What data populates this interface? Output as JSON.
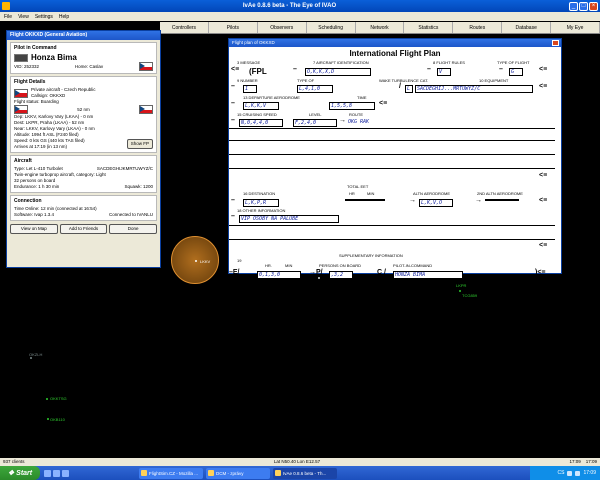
{
  "window": {
    "title": "IvAe 0.8.6 beta - The Eye of IVAO"
  },
  "menu": [
    "File",
    "View",
    "Settings",
    "Help"
  ],
  "toolbar": [
    "Controllers",
    "Pilots",
    "Observers",
    "Scheduling",
    "Network",
    "Statistics",
    "Routes",
    "Database",
    "My Eye"
  ],
  "pilot_panel": {
    "title": "Flight OKKXD (General Aviation)",
    "sec_pilot": "Pilot in Command",
    "pilot_name": "Honza Bima",
    "vid": "VID: 252332",
    "home": "Home: Caslav",
    "sec_details": "Flight Details",
    "aircraft_info": "Private aircraft - Czech Republic",
    "callsign": "Callsign: OKKXD",
    "status": "Flight status: Boarding",
    "distance": "52 nm",
    "dep": "Dep: LKKV, Karlovy Vary (LKAA) - 0 nm",
    "dest": "Dest: LKPR, Praha (LKAA) - 52 nm",
    "near": "Near: LKKV, Karlovy Vary (LKAA) - 0 nm",
    "altitude": "Altitude: 1994 ft ASL (F240 filed)",
    "speed": "Speed: 0 kts GS (440 kts TAS filed)",
    "arrives": "Arrives at 17:19 (in 13 nm)",
    "show_fp": "Show FP",
    "sec_aircraft": "Aircraft",
    "type": "Type: Let L-410 Turbolet",
    "equipment": "SACDEGHIJKMRTUWYZ/C",
    "desc1": "Twin-engine turboprop aircraft, category: Light",
    "desc2": "32 persons on board",
    "endurance": "Endurance: 1 h 30 min",
    "squawk": "Squawk: 1200",
    "sec_conn": "Connection",
    "time_online": "Time Online: 12 min  (connected at 16:54)",
    "software": "Software: Ivap 1.3.4",
    "server": "Connected to IVANLU",
    "btn_map": "View on Map",
    "btn_friends": "Add to Friends",
    "btn_done": "Done"
  },
  "flightplan": {
    "title": "Flight plan of OKKXD",
    "heading": "International Flight Plan",
    "l_message": "3   MESSAGE",
    "fpl": "(FPL",
    "l_ident": "7   AIRCRAFT IDENTIFICATION",
    "ident": "O,K,K,X,D",
    "l_rules": "8   FLIGHT RULES",
    "rules": "V",
    "l_typeflight": "TYPE OF FLIGHT",
    "typeflight": "G",
    "l_number": "9   NUMBER",
    "number": "1",
    "l_type": "TYPE OF",
    "type": "L,4,1,0",
    "l_wake": "WAKE TURBULENCE CAT.",
    "wake": "L",
    "l_equip": "10  EQUIPMENT",
    "equip": "SACDEGHIJ...MRTUWYZ/C",
    "l_dep": "13  DEPARTURE AERODROME",
    "dep": "L,K,K,V",
    "l_time": "TIME",
    "time": "1,5,5,8",
    "l_speed": "15  CRUISING SPEED",
    "speed": "N,0,4,4,0",
    "l_level": "LEVEL",
    "level": "F,2,4,0",
    "l_route": "ROUTE",
    "route": "OKG RAK",
    "l_total_eet": "TOTAL EET",
    "l_hr": "HR",
    "l_min": "MIN",
    "l_dest": "16  DESTINATION",
    "dest": "L,K,P,R",
    "l_altn": "ALTN AERODROME",
    "altn": "L,K,V,O",
    "l_altn2": "2ND ALTN AERODROME",
    "l_other": "18  OTHER INFORMATION",
    "other": "VIP OSOBY NA PALUBE",
    "l_supp": "SUPPLEMENTARY INFORMATION",
    "l_19": "19",
    "l_endur_hr": "HR.",
    "l_endur_min": "MIN",
    "endurance": "0,1,3,0",
    "l_persons": "PERSONS ON BOARD",
    "persons": ",3,2",
    "l_pic": "PILOT-IN-COMMAND",
    "pic": "HONZA BIMA"
  },
  "radar": {
    "airport_label": "LKKV",
    "tags": [
      "LKPR",
      "TCG859",
      "OKZLH",
      "OKKTSG",
      "OKB110"
    ]
  },
  "status": {
    "clients": "937 clients",
    "coords": "Lat N50.40 Lon E12.57",
    "time1": "17:09",
    "time2": "17:09"
  },
  "taskbar": {
    "start": "Start",
    "tasks": [
      "FlightSim.CZ - Mozilla ...",
      "DCM - zprávy",
      "IvAe 0.8.6 beta - Th..."
    ],
    "clock": "17:09",
    "lang": "CS"
  }
}
